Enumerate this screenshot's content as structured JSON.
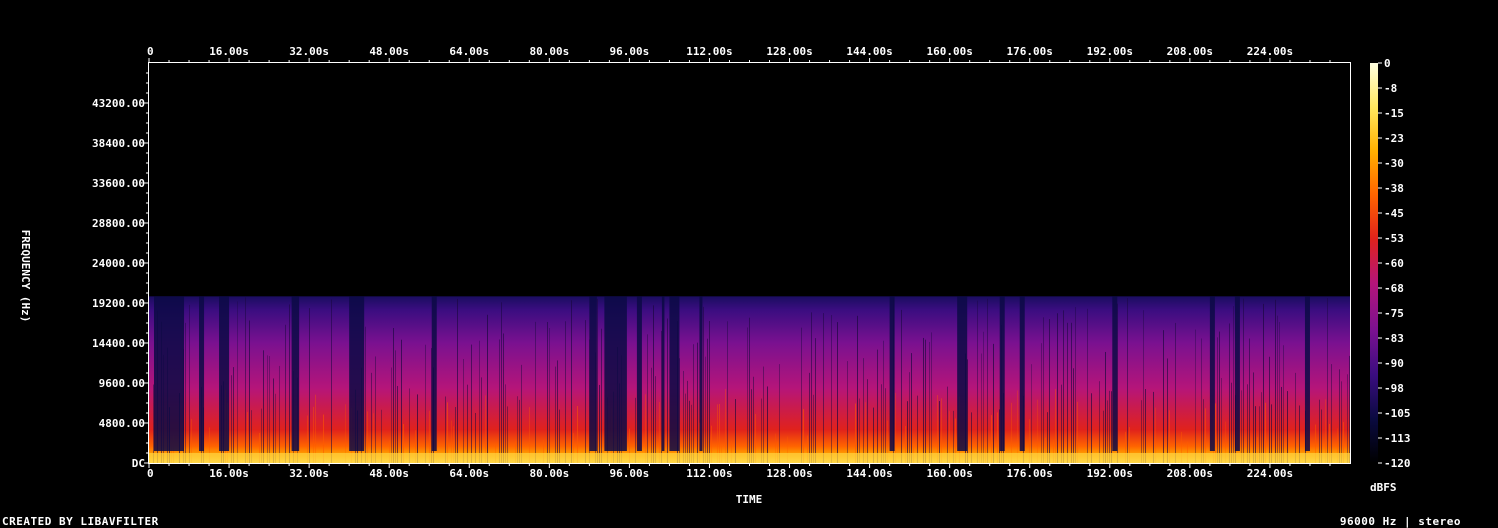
{
  "chart_data": {
    "type": "heatmap",
    "title": "",
    "xlabel": "TIME",
    "ylabel": "FREQUENCY (Hz)",
    "x_ticks": [
      "0",
      "16.00s",
      "32.00s",
      "48.00s",
      "64.00s",
      "80.00s",
      "96.00s",
      "112.00s",
      "128.00s",
      "144.00s",
      "160.00s",
      "176.00s",
      "192.00s",
      "208.00s",
      "224.00s"
    ],
    "x_tick_values": [
      0,
      16,
      32,
      48,
      64,
      80,
      96,
      112,
      128,
      144,
      160,
      176,
      192,
      208,
      224
    ],
    "xlim": [
      0,
      240
    ],
    "y_ticks": [
      "DC",
      "4800.00",
      "9600.00",
      "14400.00",
      "19200.00",
      "24000.00",
      "28800.00",
      "33600.00",
      "38400.00",
      "43200.00"
    ],
    "y_tick_values": [
      0,
      4800,
      9600,
      14400,
      19200,
      24000,
      28800,
      33600,
      38400,
      43200
    ],
    "ylim": [
      0,
      48000
    ],
    "content_max_frequency_hz": 20000,
    "colorbar": {
      "label": "dBFS",
      "ticks": [
        "0",
        "-8",
        "-15",
        "-23",
        "-30",
        "-38",
        "-45",
        "-53",
        "-60",
        "-68",
        "-75",
        "-83",
        "-90",
        "-98",
        "-105",
        "-113",
        "-120"
      ],
      "range": [
        -120,
        0
      ],
      "colors": [
        "#000000",
        "#0a0a40",
        "#3a0d80",
        "#7a1190",
        "#b5157a",
        "#e0221c",
        "#ff6400",
        "#ffb000",
        "#ffe860",
        "#ffffe0"
      ]
    },
    "quiet_segments_s": [
      [
        1,
        7
      ],
      [
        10,
        11
      ],
      [
        14,
        16
      ],
      [
        28.5,
        30
      ],
      [
        40,
        43
      ],
      [
        56.5,
        57.5
      ],
      [
        88,
        89.5
      ],
      [
        91,
        95.5
      ],
      [
        97.5,
        98.5
      ],
      [
        102.5,
        103
      ],
      [
        104,
        106
      ],
      [
        110,
        110.6
      ],
      [
        148,
        149
      ],
      [
        161.5,
        163.5
      ],
      [
        170,
        171
      ],
      [
        174,
        175
      ],
      [
        192.5,
        193.5
      ],
      [
        212,
        213
      ],
      [
        217,
        218
      ],
      [
        231,
        232
      ]
    ]
  },
  "footer": {
    "left": "CREATED BY LIBAVFILTER",
    "right": "96000 Hz | stereo"
  }
}
